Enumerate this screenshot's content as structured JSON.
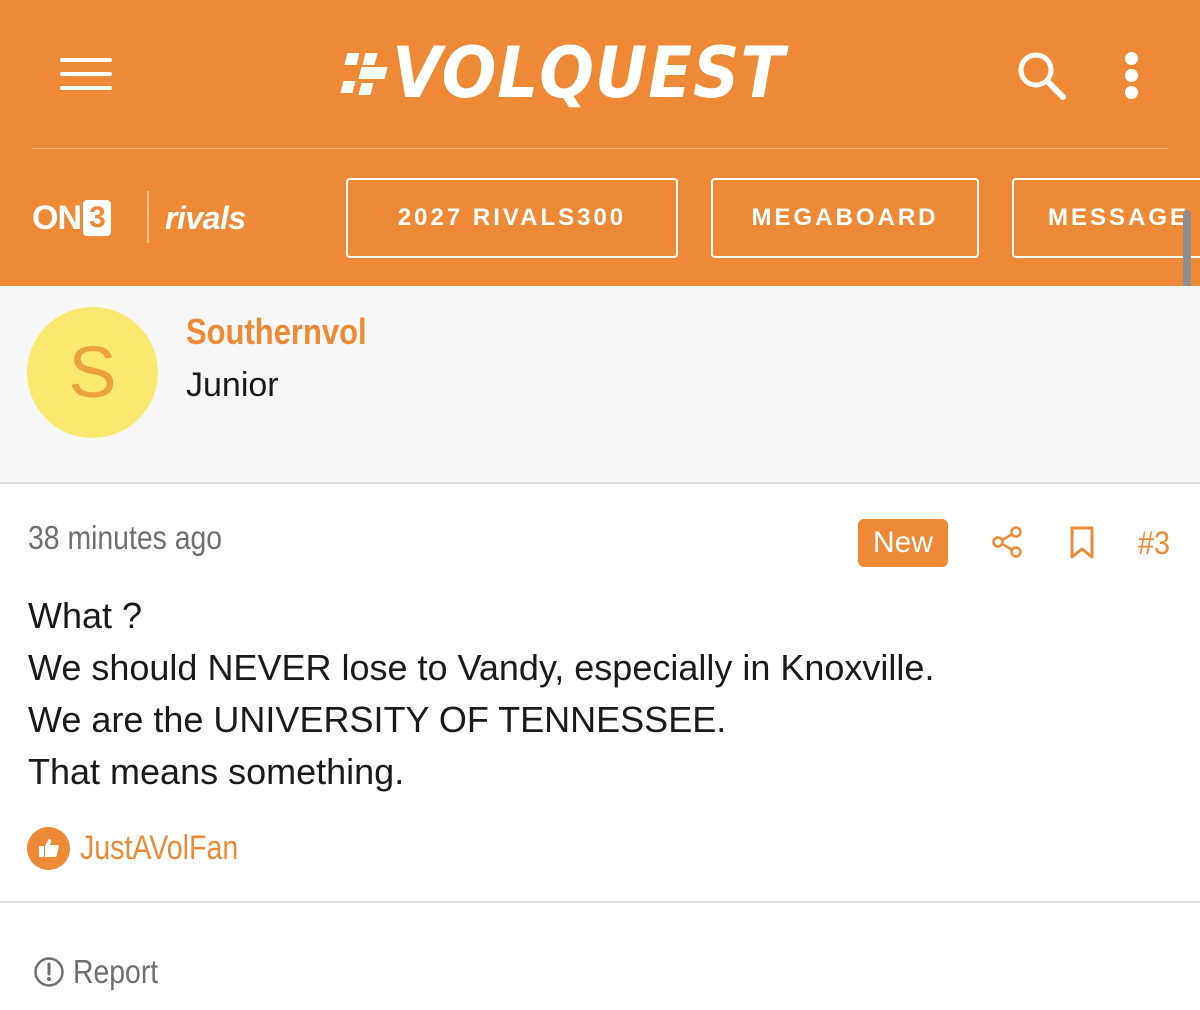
{
  "header": {
    "logo_text": "VOLQUEST",
    "brand_on3": "ON",
    "brand_on3_num": "3",
    "brand_rivals": "rivals",
    "nav": [
      {
        "label": "2027 RIVALS300"
      },
      {
        "label": "MEGABOARD"
      },
      {
        "label": "MESSAGE"
      }
    ],
    "icons": {
      "menu": "hamburger-menu-icon",
      "search": "search-icon",
      "more": "more-vertical-icon"
    },
    "bg_color": "#EE8A36"
  },
  "author": {
    "avatar_initial": "S",
    "avatar_color": "#FAE96E",
    "username": "Southernvol",
    "title": "Junior"
  },
  "post": {
    "time": "38 minutes ago",
    "badge": "New",
    "number": "#3",
    "lines": [
      "What ?",
      "We should NEVER lose to Vandy, especially in Knoxville.",
      "We are the UNIVERSITY OF TENNESSEE.",
      "That means something."
    ],
    "reaction_user": "JustAVolFan",
    "report_label": "Report"
  },
  "accent_color": "#EE8A36"
}
